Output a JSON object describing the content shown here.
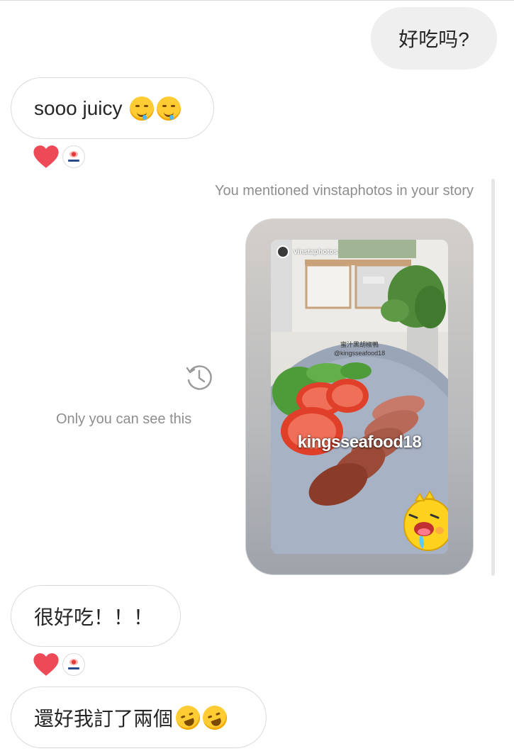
{
  "messages": [
    {
      "id": "m1",
      "direction": "out",
      "text": "好吃吗?"
    },
    {
      "id": "m2",
      "direction": "in",
      "text": "sooo juicy",
      "emojis": [
        "drooling-face",
        "drooling-face"
      ]
    },
    {
      "id": "m3",
      "direction": "in",
      "text": "很好吃！！！"
    },
    {
      "id": "m4",
      "direction": "in",
      "text": "還好我訂了兩個",
      "emojis": [
        "rolling-on-floor-laughing",
        "rolling-on-floor-laughing"
      ]
    }
  ],
  "reactions": {
    "emoji": "heart",
    "color": "#ed4956"
  },
  "story_share": {
    "mention_text": "You mentioned vinstaphotos in your story",
    "private_note": "Only you can see this",
    "story_username": "vinstaphotos",
    "caption_line1": "蜜汁黑胡椒鴨",
    "caption_line2": "@kingsseafood18",
    "mention_sticker": "kingsseafood18",
    "sticker": "drooling-cartoon-sticker"
  },
  "colors": {
    "outgoing_bubble": "#efefef",
    "incoming_border": "#dbdbdb",
    "meta_text": "#8e8e8e",
    "heart": "#ed4956"
  }
}
